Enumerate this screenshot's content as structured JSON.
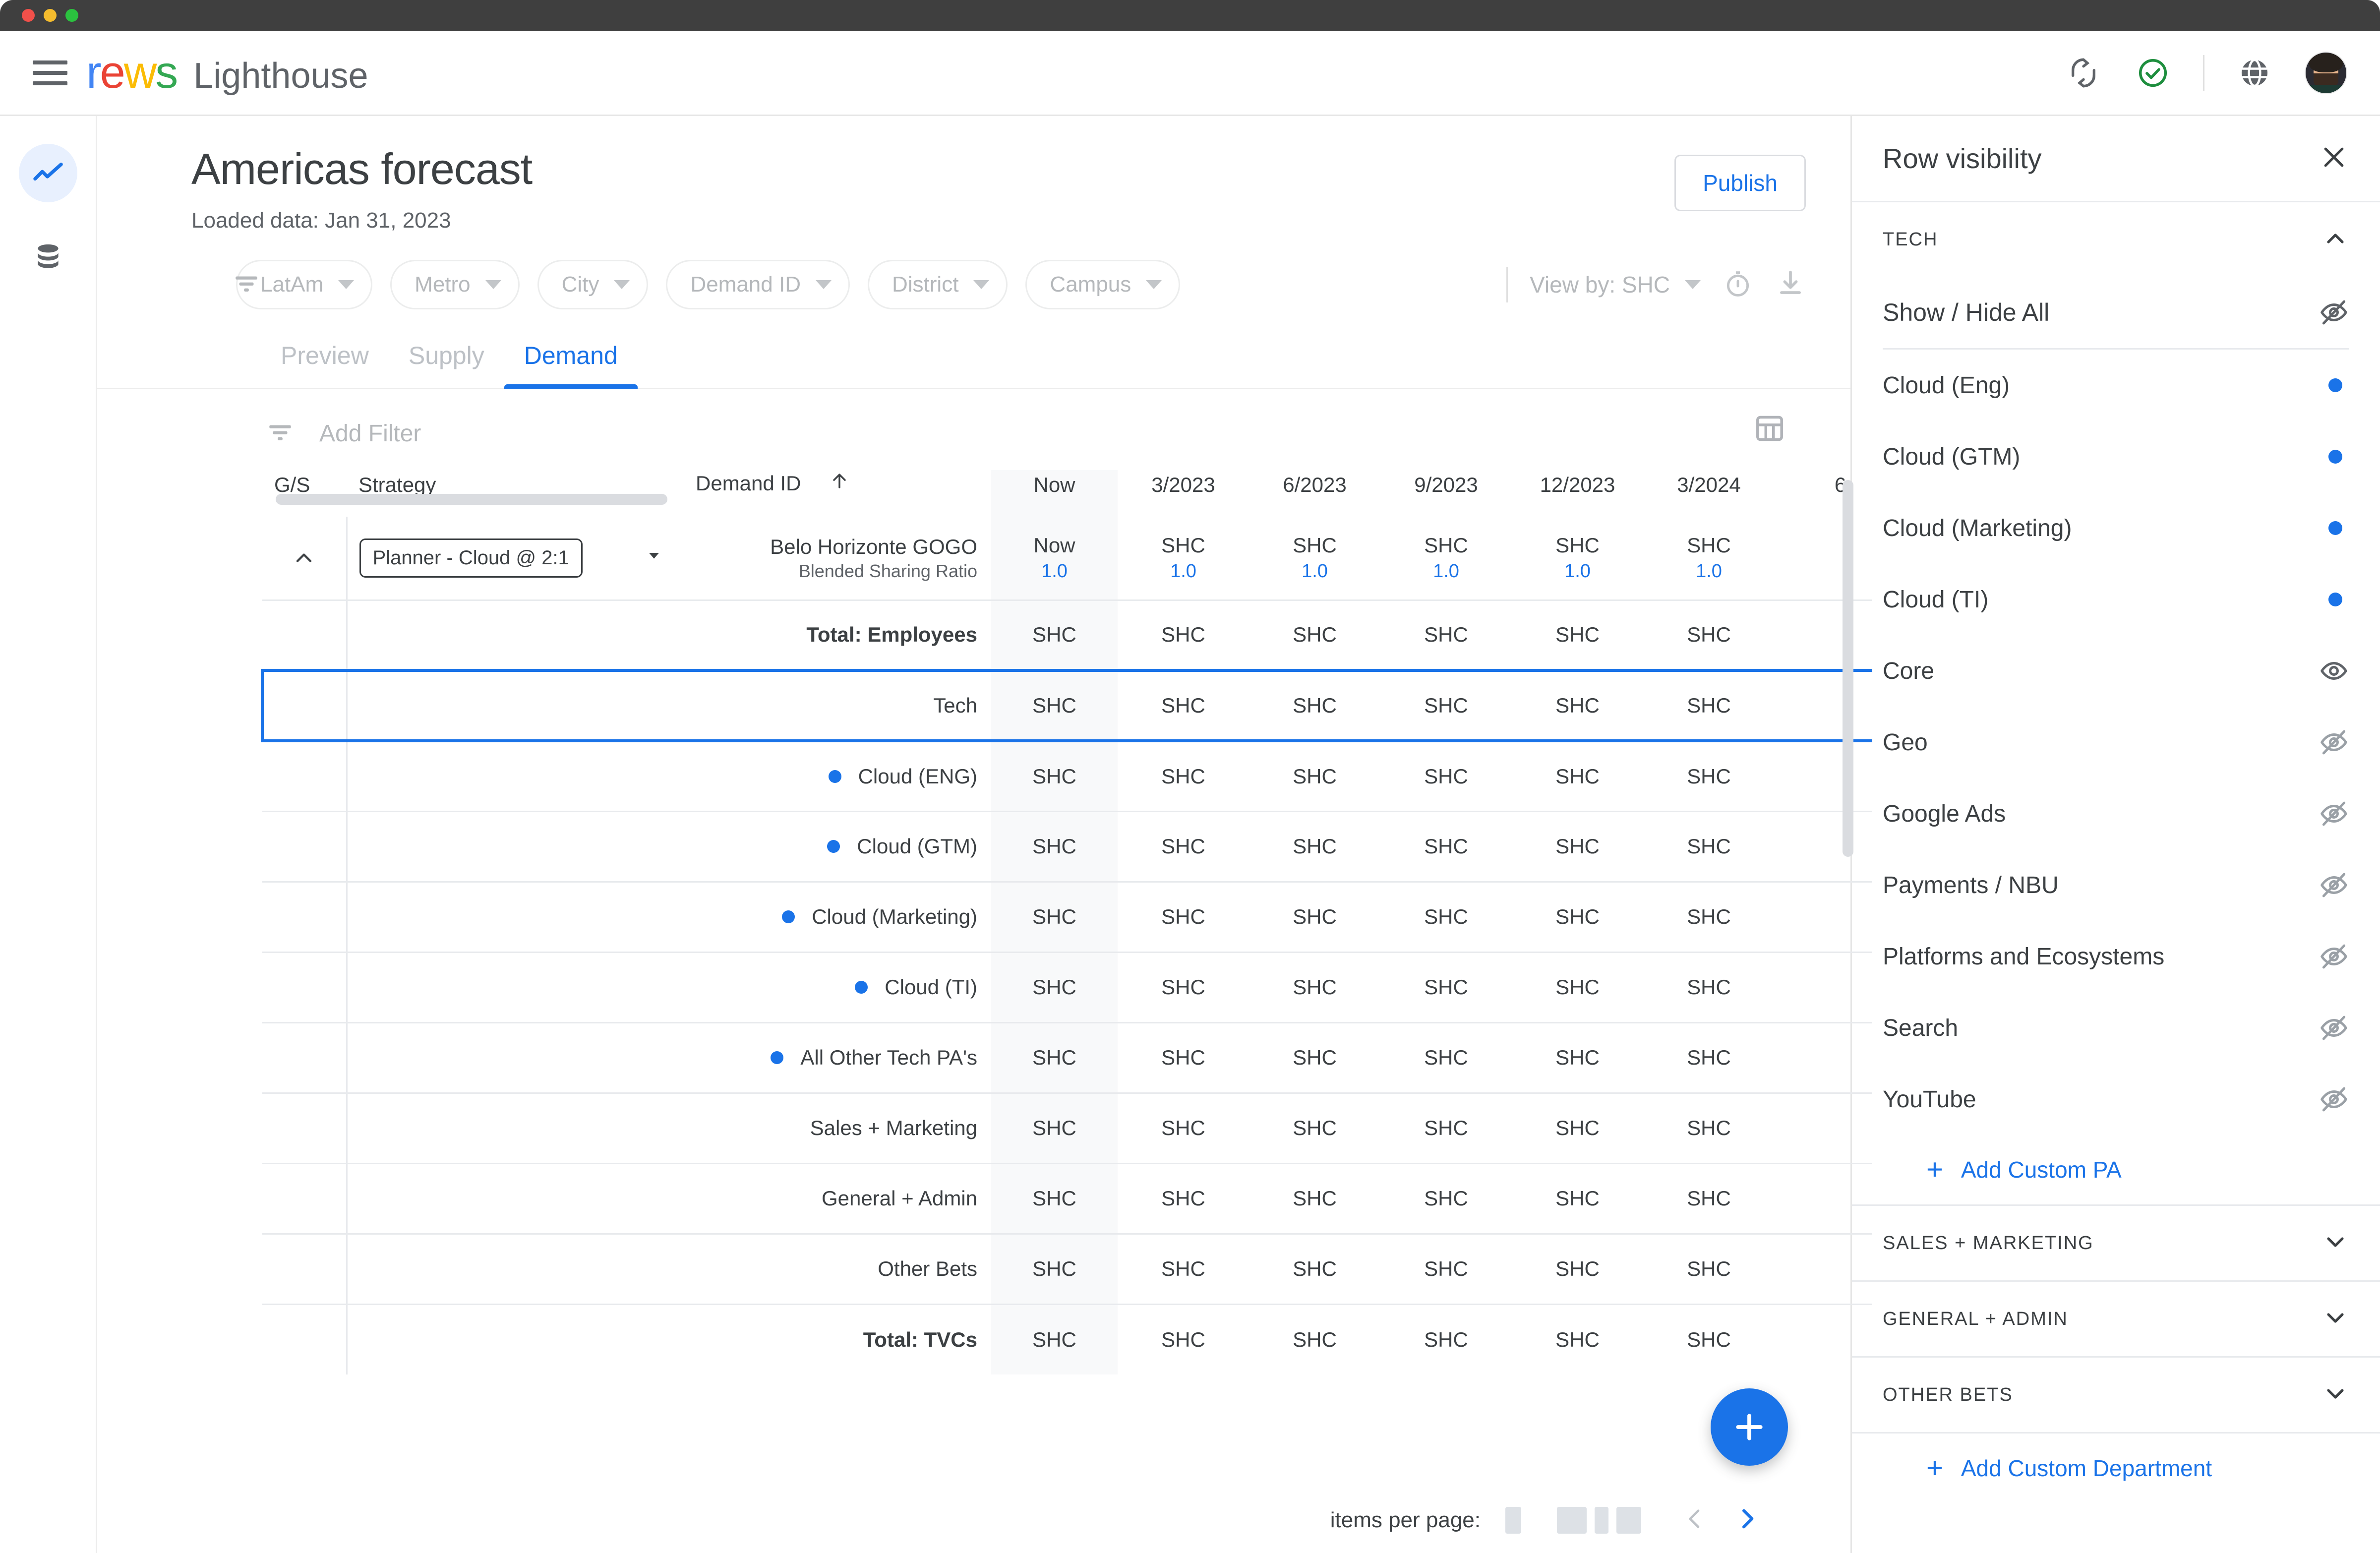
{
  "window": {
    "dots": [
      "close",
      "minimize",
      "maximize"
    ]
  },
  "appbar": {
    "menu_icon": "hamburger-icon",
    "logo_parts": [
      "r",
      "e",
      "w",
      "s"
    ],
    "product": "Lighthouse",
    "actions": [
      "sync-icon",
      "check-circle-icon",
      "globe-icon",
      "avatar"
    ]
  },
  "rail": {
    "items": [
      {
        "name": "forecast",
        "icon": "trending-up-icon",
        "active": true
      },
      {
        "name": "data",
        "icon": "database-icon",
        "active": false
      }
    ]
  },
  "page": {
    "title": "Americas forecast",
    "subtitle": "Loaded data: Jan 31, 2023",
    "publish_label": "Publish"
  },
  "filters": {
    "filter_icon": "filter-list-icon",
    "chips": [
      "LatAm",
      "Metro",
      "City",
      "Demand ID",
      "District",
      "Campus"
    ],
    "view_by_label": "View by: SHC",
    "history_icon": "timer-icon",
    "download_icon": "download-icon"
  },
  "tabs": [
    {
      "label": "Preview",
      "active": false
    },
    {
      "label": "Supply",
      "active": false
    },
    {
      "label": "Demand",
      "active": true
    }
  ],
  "table_toolbar": {
    "add_filter_label": "Add Filter",
    "filter_icon": "filter-list-icon",
    "columns_icon": "table-columns-icon"
  },
  "table": {
    "headers": {
      "gs": "G/S",
      "strategy": "Strategy",
      "demand_id": "Demand ID",
      "sort_icon": "arrow-up-icon",
      "now": "Now",
      "dates": [
        "3/2023",
        "6/2023",
        "9/2023",
        "12/2023",
        "3/2024",
        "6"
      ]
    },
    "first_row": {
      "collapse_icon": "chevron-up-icon",
      "strategy_chip": "Planner - Cloud @ 2:1",
      "strategy_caret": "chevron-down-icon",
      "demand_title": "Belo Horizonte GOGO",
      "demand_sub": "Blended Sharing Ratio",
      "now_unit": "Now",
      "now_value": "1.0",
      "cells": [
        {
          "unit": "SHC",
          "value": "1.0"
        },
        {
          "unit": "SHC",
          "value": "1.0"
        },
        {
          "unit": "SHC",
          "value": "1.0"
        },
        {
          "unit": "SHC",
          "value": "1.0"
        },
        {
          "unit": "SHC",
          "value": "1.0"
        }
      ]
    },
    "rows": [
      {
        "label": "Total: Employees",
        "bold": true,
        "bullet": false,
        "selected": false,
        "cells": [
          "SHC",
          "SHC",
          "SHC",
          "SHC",
          "SHC",
          "SHC"
        ]
      },
      {
        "label": "Tech",
        "bold": false,
        "bullet": false,
        "selected": true,
        "cells": [
          "SHC",
          "SHC",
          "SHC",
          "SHC",
          "SHC",
          "SHC"
        ]
      },
      {
        "label": "Cloud (ENG)",
        "bold": false,
        "bullet": true,
        "selected": false,
        "cells": [
          "SHC",
          "SHC",
          "SHC",
          "SHC",
          "SHC",
          "SHC"
        ]
      },
      {
        "label": "Cloud (GTM)",
        "bold": false,
        "bullet": true,
        "selected": false,
        "cells": [
          "SHC",
          "SHC",
          "SHC",
          "SHC",
          "SHC",
          "SHC"
        ]
      },
      {
        "label": "Cloud (Marketing)",
        "bold": false,
        "bullet": true,
        "selected": false,
        "cells": [
          "SHC",
          "SHC",
          "SHC",
          "SHC",
          "SHC",
          "SHC"
        ]
      },
      {
        "label": "Cloud (TI)",
        "bold": false,
        "bullet": true,
        "selected": false,
        "cells": [
          "SHC",
          "SHC",
          "SHC",
          "SHC",
          "SHC",
          "SHC"
        ]
      },
      {
        "label": "All Other Tech PA's",
        "bold": false,
        "bullet": true,
        "selected": false,
        "cells": [
          "SHC",
          "SHC",
          "SHC",
          "SHC",
          "SHC",
          "SHC"
        ]
      },
      {
        "label": "Sales + Marketing",
        "bold": false,
        "bullet": false,
        "selected": false,
        "cells": [
          "SHC",
          "SHC",
          "SHC",
          "SHC",
          "SHC",
          "SHC"
        ]
      },
      {
        "label": "General + Admin",
        "bold": false,
        "bullet": false,
        "selected": false,
        "cells": [
          "SHC",
          "SHC",
          "SHC",
          "SHC",
          "SHC",
          "SHC"
        ]
      },
      {
        "label": "Other Bets",
        "bold": false,
        "bullet": false,
        "selected": false,
        "cells": [
          "SHC",
          "SHC",
          "SHC",
          "SHC",
          "SHC",
          "SHC"
        ]
      },
      {
        "label": "Total: TVCs",
        "bold": true,
        "bullet": false,
        "selected": false,
        "cells": [
          "SHC",
          "SHC",
          "SHC",
          "SHC",
          "SHC",
          "SHC"
        ]
      }
    ]
  },
  "fab": {
    "icon": "plus-icon"
  },
  "paginator": {
    "label": "items per page:",
    "prev_icon": "chevron-left-icon",
    "next_icon": "chevron-right-icon"
  },
  "drawer": {
    "title": "Row visibility",
    "close_icon": "close-icon",
    "sections": [
      {
        "title": "TECH",
        "expanded": true,
        "chevron": "chevron-up-icon",
        "show_hide_all": {
          "label": "Show / Hide All",
          "icon": "eye-off-icon"
        },
        "items": [
          {
            "label": "Cloud (Eng)",
            "state": "dot"
          },
          {
            "label": "Cloud (GTM)",
            "state": "dot"
          },
          {
            "label": "Cloud (Marketing)",
            "state": "dot"
          },
          {
            "label": "Cloud (TI)",
            "state": "dot"
          },
          {
            "label": "Core",
            "state": "visible"
          },
          {
            "label": "Geo",
            "state": "hidden"
          },
          {
            "label": "Google Ads",
            "state": "hidden"
          },
          {
            "label": "Payments / NBU",
            "state": "hidden"
          },
          {
            "label": "Platforms and Ecosystems",
            "state": "hidden"
          },
          {
            "label": "Search",
            "state": "hidden"
          },
          {
            "label": "YouTube",
            "state": "hidden"
          }
        ],
        "add_label": "Add Custom PA"
      },
      {
        "title": "SALES + MARKETING",
        "expanded": false,
        "chevron": "chevron-down-icon"
      },
      {
        "title": "GENERAL + ADMIN",
        "expanded": false,
        "chevron": "chevron-down-icon"
      },
      {
        "title": "OTHER BETS",
        "expanded": false,
        "chevron": "chevron-down-icon"
      }
    ],
    "add_department_label": "Add Custom Department"
  },
  "colors": {
    "accent": "#1a73e8",
    "accent_light": "#e8f0fe",
    "text": "#3c4043",
    "muted": "#5f6368",
    "placeholder": "#b5b8bb",
    "success": "#1e8e3e",
    "border": "#e8eaed"
  }
}
